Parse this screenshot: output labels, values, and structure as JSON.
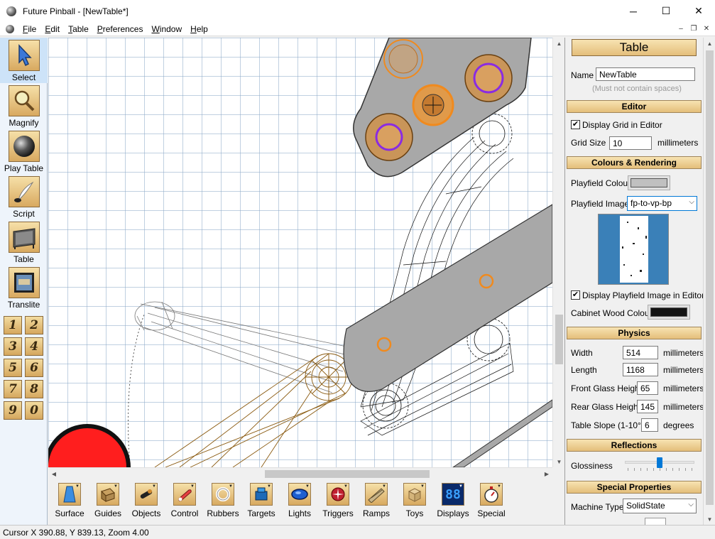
{
  "window": {
    "title": "Future Pinball - [NewTable*]",
    "minimize": "─",
    "maximize": "☐",
    "close": "✕"
  },
  "menu": {
    "items": [
      "File",
      "Edit",
      "Table",
      "Preferences",
      "Window",
      "Help"
    ],
    "mdi_minimize": "–",
    "mdi_restore": "❐",
    "mdi_close": "✕"
  },
  "tools": [
    {
      "label": "Select",
      "icon": "arrow-cursor-icon",
      "active": true
    },
    {
      "label": "Magnify",
      "icon": "magnifier-icon",
      "active": false
    },
    {
      "label": "Play Table",
      "icon": "pinball-ball-icon",
      "active": false
    },
    {
      "label": "Script",
      "icon": "quill-pen-icon",
      "active": false
    },
    {
      "label": "Table",
      "icon": "pinball-table-icon",
      "active": false
    },
    {
      "label": "Translite",
      "icon": "translite-icon",
      "active": false
    }
  ],
  "number_buttons": [
    "1",
    "2",
    "3",
    "4",
    "5",
    "6",
    "7",
    "8",
    "9",
    "0"
  ],
  "bottom_tools": [
    {
      "label": "Surface",
      "icon": "surface-icon"
    },
    {
      "label": "Guides",
      "icon": "guides-icon"
    },
    {
      "label": "Objects",
      "icon": "objects-icon"
    },
    {
      "label": "Control",
      "icon": "control-icon"
    },
    {
      "label": "Rubbers",
      "icon": "rubbers-icon"
    },
    {
      "label": "Targets",
      "icon": "targets-icon"
    },
    {
      "label": "Lights",
      "icon": "lights-icon"
    },
    {
      "label": "Triggers",
      "icon": "triggers-icon"
    },
    {
      "label": "Ramps",
      "icon": "ramps-icon"
    },
    {
      "label": "Toys",
      "icon": "toys-icon"
    },
    {
      "label": "Displays",
      "icon": "displays-icon"
    },
    {
      "label": "Special",
      "icon": "special-icon"
    }
  ],
  "displays_glyph": "88",
  "status": {
    "text": "Cursor X 390.88, Y 839.13, Zoom 4.00"
  },
  "properties": {
    "header": "Table",
    "name_label": "Name",
    "name_value": "NewTable",
    "name_hint": "(Must not contain spaces)",
    "editor": {
      "header": "Editor",
      "display_grid_label": "Display Grid in Editor",
      "display_grid_checked": "✔",
      "grid_size_label": "Grid Size",
      "grid_size_value": "10",
      "grid_size_unit": "millimeters"
    },
    "colours": {
      "header": "Colours & Rendering",
      "playfield_colour_label": "Playfield Colour",
      "playfield_colour": "#c0c0c0",
      "playfield_image_label": "Playfield Image",
      "playfield_image_value": "fp-to-vp-bp",
      "display_image_label": "Display Playfield Image in Editor",
      "display_image_checked": "✔",
      "cabinet_wood_label": "Cabinet Wood Colour",
      "cabinet_wood_colour": "#141414"
    },
    "physics": {
      "header": "Physics",
      "width_label": "Width",
      "width_value": "514",
      "width_unit": "millimeters",
      "length_label": "Length",
      "length_value": "1168",
      "length_unit": "millimeters",
      "front_glass_label": "Front Glass Height",
      "front_glass_value": "65",
      "front_glass_unit": "millimeters",
      "rear_glass_label": "Rear Glass Height",
      "rear_glass_value": "145",
      "rear_glass_unit": "millimeters",
      "slope_label": "Table Slope (1-10°)",
      "slope_value": "6",
      "slope_unit": "degrees"
    },
    "reflections": {
      "header": "Reflections",
      "glossiness_label": "Glossiness",
      "glossiness_level": 0.5
    },
    "special": {
      "header": "Special Properties",
      "machine_type_label": "Machine Type",
      "machine_type_value": "SolidState"
    }
  },
  "colors": {
    "accent": "#0078d7",
    "header_gold": "#e4be7a",
    "orange_bumper": "#f08a1e",
    "purple_ring": "#8a2be2",
    "red_ball": "#ff1e1e",
    "ramp_gray": "#a8a8a8"
  }
}
